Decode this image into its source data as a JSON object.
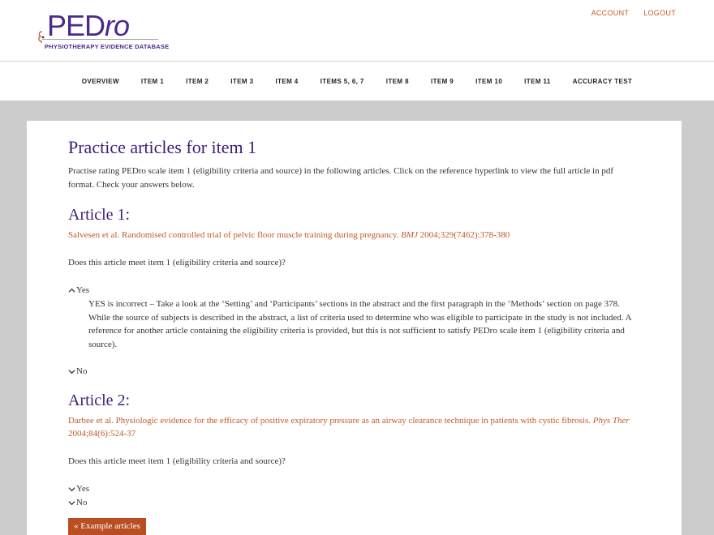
{
  "logo": {
    "word_ped": "PED",
    "word_ro": "ro",
    "tagline": "PHYSIOTHERAPY EVIDENCE DATABASE"
  },
  "account": {
    "account_label": "ACCOUNT",
    "logout_label": "LOGOUT"
  },
  "nav": {
    "items": [
      "OVERVIEW",
      "ITEM 1",
      "ITEM 2",
      "ITEM 3",
      "ITEM 4",
      "ITEMS 5, 6, 7",
      "ITEM 8",
      "ITEM 9",
      "ITEM 10",
      "ITEM 11",
      "ACCURACY TEST"
    ]
  },
  "main": {
    "title": "Practice articles for item 1",
    "intro": "Practise rating PEDro scale item 1 (eligibility criteria and source) in the following articles. Click on the reference hyperlink to view the full article in pdf format. Check your answers below.",
    "articles": [
      {
        "heading": "Article 1:",
        "ref_text": "Salvesen et al. Randomised controlled trial of pelvic floor muscle training during pregnancy. ",
        "ref_journal": "BMJ",
        "ref_cite": " 2004;329(7462):378-380",
        "question": "Does this article meet item 1 (eligibility criteria and source)?",
        "yes_label": "Yes",
        "yes_answer": "YES is incorrect – Take a look at the ‘Setting’ and ‘Participants’ sections in the abstract and the first paragraph in the ‘Methods’ section on page 378. While the source of subjects is described in the abstract, a list of criteria used to determine who was eligible to participate in the study is not included. A reference for another article containing the eligibility criteria is provided, but this is not sufficient to satisfy PEDro scale item 1 (eligibility criteria and source).",
        "no_label": "No"
      },
      {
        "heading": "Article 2:",
        "ref_text": "Darbee et al. Physiologic evidence for the efficacy of positive expiratory pressure as an airway clearance technique in patients with cystic fibrosis. ",
        "ref_journal": "Phys Ther",
        "ref_cite": " 2004;84(6):524-37",
        "question": "Does this article meet item 1 (eligibility criteria and source)?",
        "yes_label": "Yes",
        "no_label": "No"
      }
    ],
    "button_label": "« Example articles"
  },
  "colors": {
    "brand_purple": "#3f1c78",
    "link_orange": "#c15a2c",
    "button_bg": "#b84e22",
    "page_gray": "#cccccc"
  }
}
